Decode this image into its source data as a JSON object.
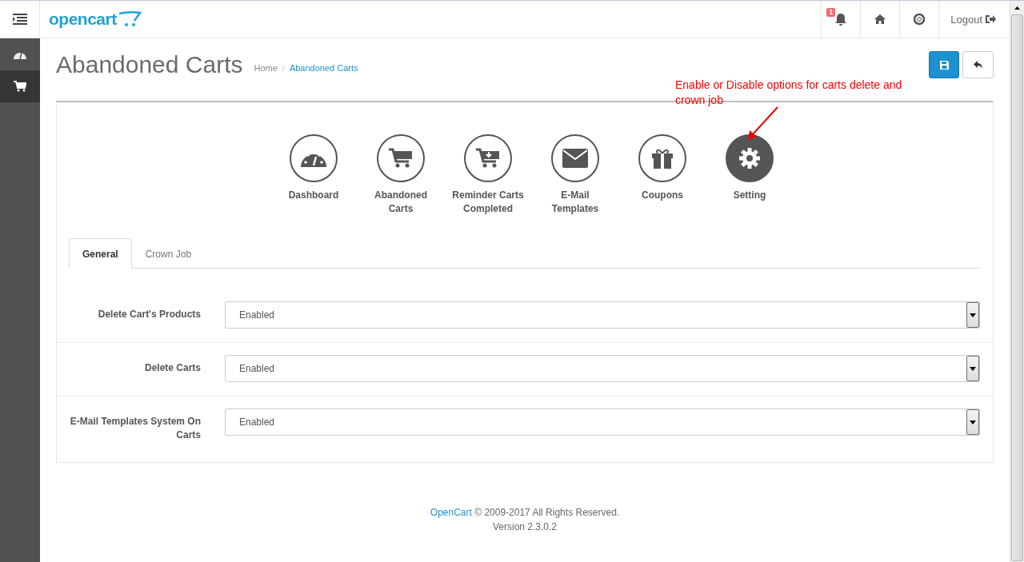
{
  "header": {
    "logo": "opencart",
    "notification_count": "1",
    "logout": "Logout"
  },
  "sidebar": {
    "items": [
      {
        "kind": "dashboard",
        "selected": false
      },
      {
        "kind": "cart",
        "selected": true
      }
    ]
  },
  "page": {
    "title": "Abandoned Carts",
    "breadcrumb_separator": "/",
    "breadcrumbs": [
      {
        "label": "Home",
        "kind": "text"
      },
      {
        "label": "Abandoned Carts",
        "kind": "link"
      }
    ]
  },
  "annotation": "Enable or Disable options for carts delete and crown job",
  "modules": [
    {
      "label": "Dashboard",
      "kind": "dashboard",
      "selected": false
    },
    {
      "label": "Abandoned Carts",
      "kind": "cart",
      "selected": false
    },
    {
      "label": "Reminder Carts Completed",
      "kind": "cart-download",
      "selected": false
    },
    {
      "label": "E-Mail Templates",
      "kind": "envelope",
      "selected": false
    },
    {
      "label": "Coupons",
      "kind": "gift",
      "selected": false
    },
    {
      "label": "Setting",
      "kind": "gear",
      "selected": true
    }
  ],
  "tabs": [
    {
      "label": "General",
      "selected": true
    },
    {
      "label": "Crown Job",
      "selected": false
    }
  ],
  "fields": [
    {
      "label": "Delete Cart's Products",
      "value": "Enabled"
    },
    {
      "label": "Delete Carts",
      "value": "Enabled"
    },
    {
      "label": "E-Mail Templates System On Carts",
      "value": "Enabled"
    }
  ],
  "footer": {
    "link": "OpenCart",
    "text": "© 2009-2017 All Rights Reserved.",
    "version": "Version 2.3.0.2"
  }
}
